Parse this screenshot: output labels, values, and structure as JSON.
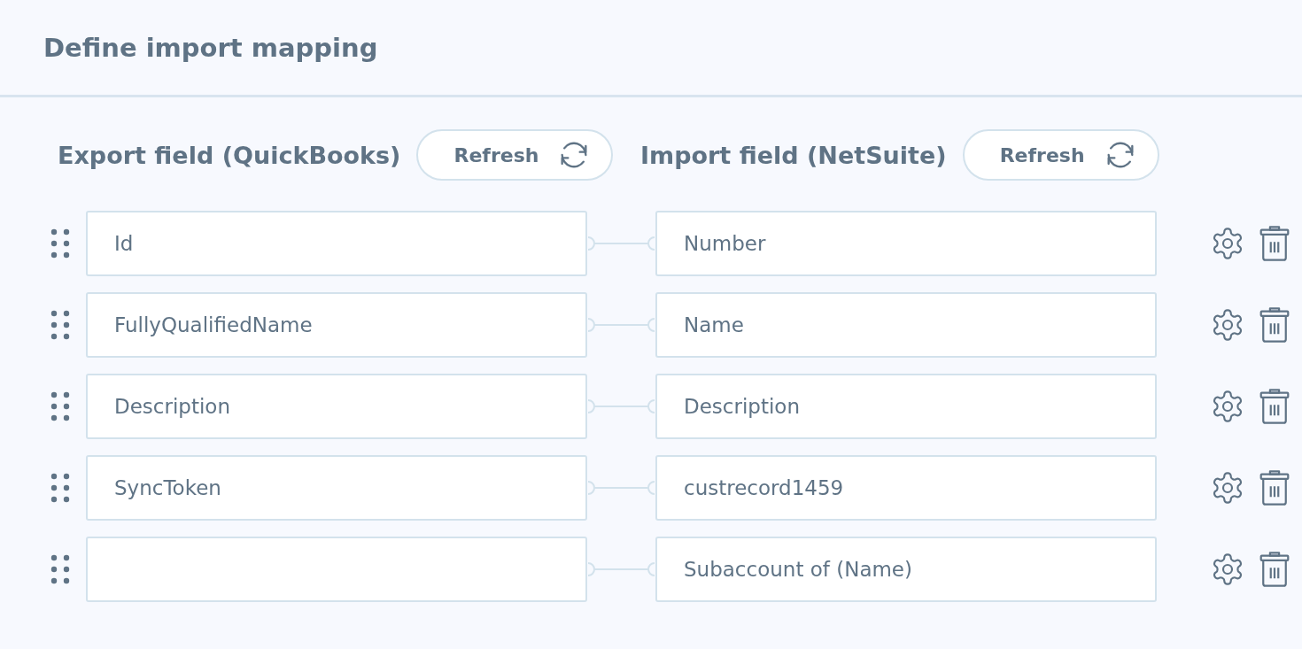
{
  "title": "Define import mapping",
  "columns": [
    {
      "label": "Export field (QuickBooks)",
      "button": "Refresh"
    },
    {
      "label": "Import field (NetSuite)",
      "button": "Refresh"
    }
  ],
  "rows": [
    {
      "export": "Id",
      "import": "Number"
    },
    {
      "export": "FullyQualifiedName",
      "import": "Name"
    },
    {
      "export": "Description",
      "import": "Description"
    },
    {
      "export": "SyncToken",
      "import": "custrecord1459"
    },
    {
      "import": "Subaccount of (Name)"
    }
  ]
}
